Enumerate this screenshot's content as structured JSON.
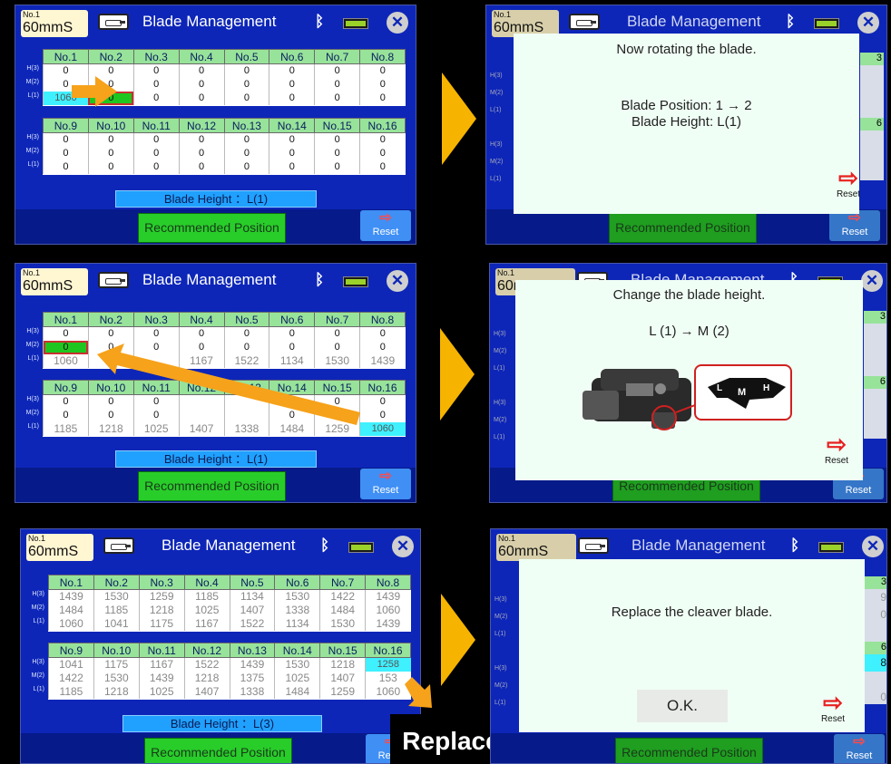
{
  "header": {
    "no": "No.1",
    "speed": "60mmS",
    "title": "Blade Management",
    "bt_icon": "bluetooth-icon",
    "battery_icon": "battery-icon",
    "close_icon": "close-icon"
  },
  "row_labels": [
    "H(3)",
    "M(2)",
    "L(1)"
  ],
  "top_cols": [
    "No.1",
    "No.2",
    "No.3",
    "No.4",
    "No.5",
    "No.6",
    "No.7",
    "No.8"
  ],
  "bot_cols": [
    "No.9",
    "No.10",
    "No.11",
    "No.12",
    "No.13",
    "No.14",
    "No.15",
    "No.16"
  ],
  "screen1": {
    "top_rows": [
      [
        "0",
        "0",
        "0",
        "0",
        "0",
        "0",
        "0",
        "0"
      ],
      [
        "0",
        "0",
        "0",
        "0",
        "0",
        "0",
        "0",
        "0"
      ],
      [
        "1060",
        "0",
        "0",
        "0",
        "0",
        "0",
        "0",
        "0"
      ]
    ],
    "bot_rows": [
      [
        "0",
        "0",
        "0",
        "0",
        "0",
        "0",
        "0",
        "0"
      ],
      [
        "0",
        "0",
        "0",
        "0",
        "0",
        "0",
        "0",
        "0"
      ],
      [
        "0",
        "0",
        "0",
        "0",
        "0",
        "0",
        "0",
        "0"
      ]
    ],
    "blade_height": "Blade Height ：L(1)"
  },
  "screen3": {
    "top_rows": [
      [
        "0",
        "0",
        "0",
        "0",
        "0",
        "0",
        "0",
        "0"
      ],
      [
        "0",
        "0",
        "0",
        "0",
        "0",
        "0",
        "0",
        "0"
      ],
      [
        "1060",
        "",
        "",
        "1167",
        "1522",
        "1134",
        "1530",
        "1439"
      ]
    ],
    "bot_rows": [
      [
        "0",
        "0",
        "0",
        "",
        "",
        "0",
        "0",
        "0"
      ],
      [
        "0",
        "0",
        "0",
        "",
        "",
        "0",
        "0",
        "0"
      ],
      [
        "1185",
        "1218",
        "1025",
        "1407",
        "1338",
        "1484",
        "1259",
        "1060"
      ]
    ],
    "blade_height": "Blade Height ：L(1)"
  },
  "screen5": {
    "top_rows": [
      [
        "1439",
        "1530",
        "1259",
        "1185",
        "1134",
        "1530",
        "1422",
        "1439"
      ],
      [
        "1484",
        "1185",
        "1218",
        "1025",
        "1407",
        "1338",
        "1484",
        "1060"
      ],
      [
        "1060",
        "1041",
        "1175",
        "1167",
        "1522",
        "1134",
        "1530",
        "1439"
      ]
    ],
    "bot_rows": [
      [
        "1041",
        "1175",
        "1167",
        "1522",
        "1439",
        "1530",
        "1218",
        "1258"
      ],
      [
        "1422",
        "1530",
        "1439",
        "1218",
        "1375",
        "1025",
        "1407",
        "153"
      ],
      [
        "1185",
        "1218",
        "1025",
        "1407",
        "1338",
        "1484",
        "1259",
        "1060"
      ]
    ],
    "blade_height": "Blade Height ：L(3)"
  },
  "footer": {
    "recommended": "Recommended Position",
    "reset": "Reset"
  },
  "dialogs": {
    "d1_title": "Now rotating the blade.",
    "d1_pos": "Blade Position: 1 → 2",
    "d1_height": "Blade Height: L(1)",
    "d2_title": "Change the blade height.",
    "d2_change": "L (1)  →  M (2)",
    "d2_mark_l": "L",
    "d2_mark_m": "M",
    "d2_mark_h": "H",
    "d3_title": "Replace the cleaver blade.",
    "d3_ok": "O.K."
  },
  "bg_partial": [
    "3",
    "6",
    "9",
    "0",
    "8",
    "0"
  ],
  "replace_label": "Replace",
  "colors": {
    "screen_bg": "#0d26b8",
    "header_green": "#98e39a",
    "cyan_cell": "#3ff0ff",
    "green_cell": "#1fc61f",
    "arrow": "#f6a21a",
    "chevron": "#f6b400"
  }
}
